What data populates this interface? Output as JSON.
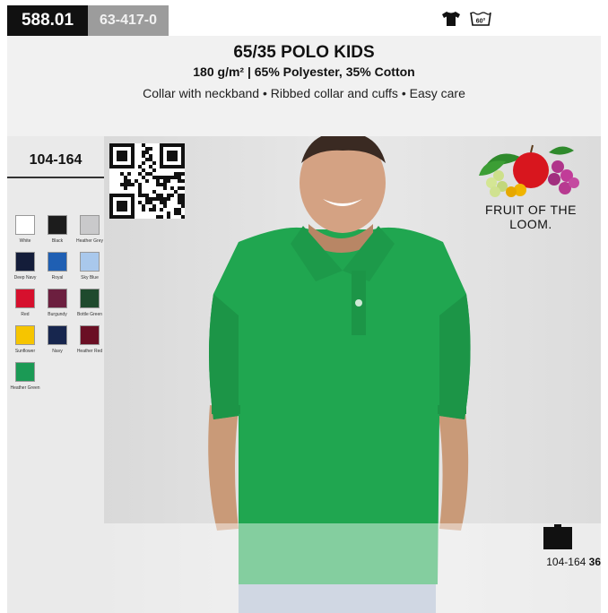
{
  "header": {
    "article_code": "588.01",
    "alt_code": "63-417-0",
    "title": "65/35 POLO KIDS",
    "subtitle": "180 g/m² | 65% Polyester, 35% Cotton",
    "features": "Collar with neckband • Ribbed collar and cuffs • Easy care"
  },
  "care": {
    "tshirt_icon": "tshirt-icon",
    "wash_icon": "wash-60-icon",
    "wash_temp": "60°"
  },
  "sizes": {
    "range": "104-164"
  },
  "colors": [
    {
      "name": "White",
      "hex": "#ffffff"
    },
    {
      "name": "Black",
      "hex": "#1c1c1c"
    },
    {
      "name": "Heather Grey",
      "hex": "#c9c9cb"
    },
    {
      "name": "Deep Navy",
      "hex": "#141d3a"
    },
    {
      "name": "Royal",
      "hex": "#1f5fb3"
    },
    {
      "name": "Sky Blue",
      "hex": "#a9c8ec"
    },
    {
      "name": "Red",
      "hex": "#d6102d"
    },
    {
      "name": "Burgundy",
      "hex": "#6c1f3f"
    },
    {
      "name": "Bottle Green",
      "hex": "#1f4a2d"
    },
    {
      "name": "Sunflower",
      "hex": "#f6c500"
    },
    {
      "name": "Navy",
      "hex": "#17264e"
    },
    {
      "name": "Heather Red",
      "hex": "#6a0f24"
    },
    {
      "name": "Heather Green",
      "hex": "#1b9a55"
    }
  ],
  "brand": {
    "logo_text": "FRUIT OF THE LOOM."
  },
  "packaging": {
    "size_range": "104-164",
    "count": "36"
  },
  "product_color": "#20a650"
}
